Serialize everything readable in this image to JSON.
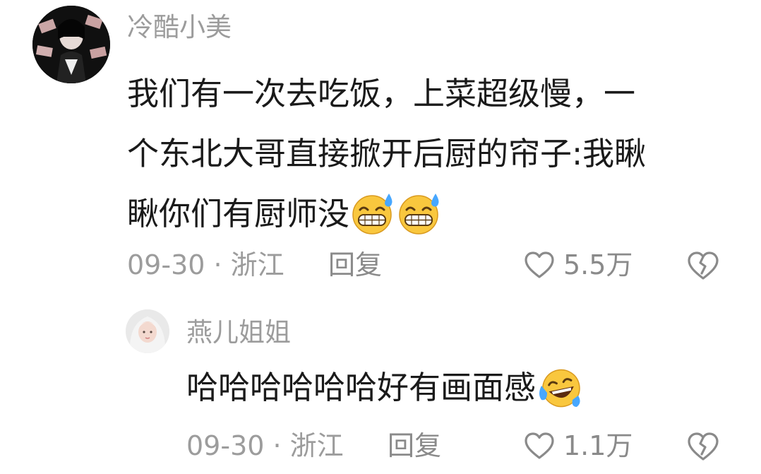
{
  "comment": {
    "username": "冷酷小美",
    "text_lines": [
      "我们有一次去吃饭，上菜超级慢，一",
      "个东北大哥直接掀开后厨的帘子:我瞅",
      "瞅你们有厨师没"
    ],
    "emojis": [
      "grin-sweat-emoji",
      "grin-sweat-emoji"
    ],
    "date_location": "09-30 · 浙江",
    "reply_label": "回复",
    "like_count": "5.5万"
  },
  "reply": {
    "username": "燕儿姐姐",
    "text": "哈哈哈哈哈哈好有画面感",
    "emojis": [
      "tears-of-joy-emoji"
    ],
    "date_location": "09-30 · 浙江",
    "reply_label": "回复",
    "like_count": "1.1万"
  },
  "colors": {
    "text_primary": "#1a1a1a",
    "text_secondary": "#9c9c9c",
    "icon": "#8a8a8a",
    "emoji_face": "#f9c73e",
    "emoji_sweat": "#47a7ff"
  }
}
